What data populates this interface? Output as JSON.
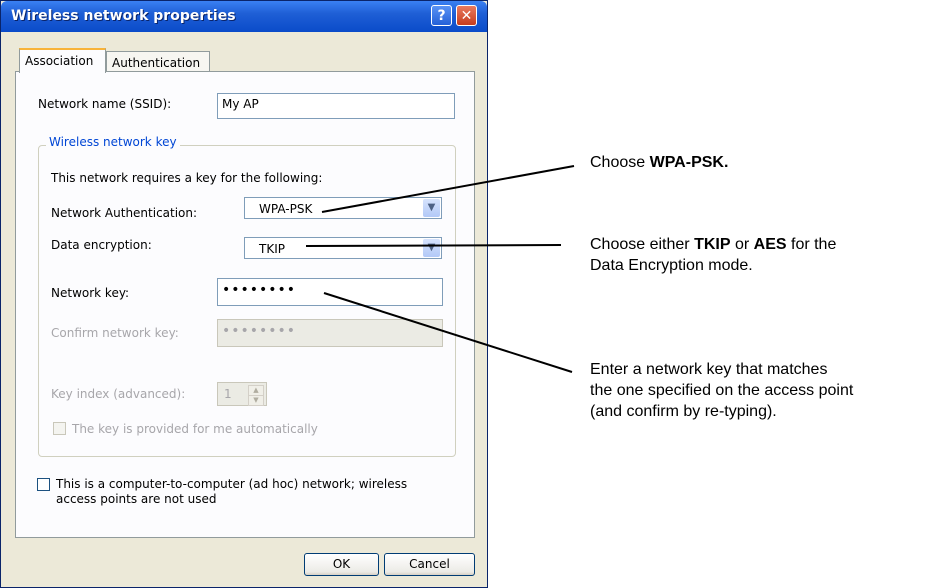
{
  "window": {
    "title": "Wireless network properties",
    "help_glyph": "?",
    "close_glyph": "✕"
  },
  "tabs": [
    {
      "label": "Association",
      "active": true
    },
    {
      "label": "Authentication",
      "active": false
    }
  ],
  "ssid": {
    "label": "Network name (SSID):",
    "value": "My AP"
  },
  "key_group": {
    "legend": "Wireless network key",
    "intro": "This network requires a key for the following:",
    "auth": {
      "label": "Network Authentication:",
      "value": "WPA-PSK"
    },
    "encryption": {
      "label": "Data encryption:",
      "value": "TKIP"
    },
    "network_key": {
      "label": "Network key:",
      "value": "••••••••"
    },
    "confirm_key": {
      "label": "Confirm network key:",
      "value": "••••••••"
    },
    "key_index": {
      "label": "Key index (advanced):",
      "value": "1"
    },
    "auto_key": {
      "label": "The key is provided for me automatically",
      "checked": false
    }
  },
  "adhoc": {
    "label_line1": "This is a computer-to-computer (ad hoc) network; wireless",
    "label_line2": "access points are not used",
    "checked": false
  },
  "buttons": {
    "ok": "OK",
    "cancel": "Cancel"
  },
  "annotations": {
    "a1": {
      "pre": "Choose ",
      "bold": "WPA-PSK."
    },
    "a2": {
      "pre": "Choose either ",
      "bold1": "TKIP",
      "mid": " or ",
      "bold2": "AES",
      "post": " for the",
      "line2": "Data Encryption mode."
    },
    "a3": {
      "line1": "Enter a network key that matches",
      "line2": "the one specified on the access point",
      "line3": "(and confirm by re-typing)."
    }
  },
  "icons": {
    "dropdown": "chevron-down-icon",
    "spin_up": "spin-up-icon",
    "spin_down": "spin-down-icon"
  }
}
